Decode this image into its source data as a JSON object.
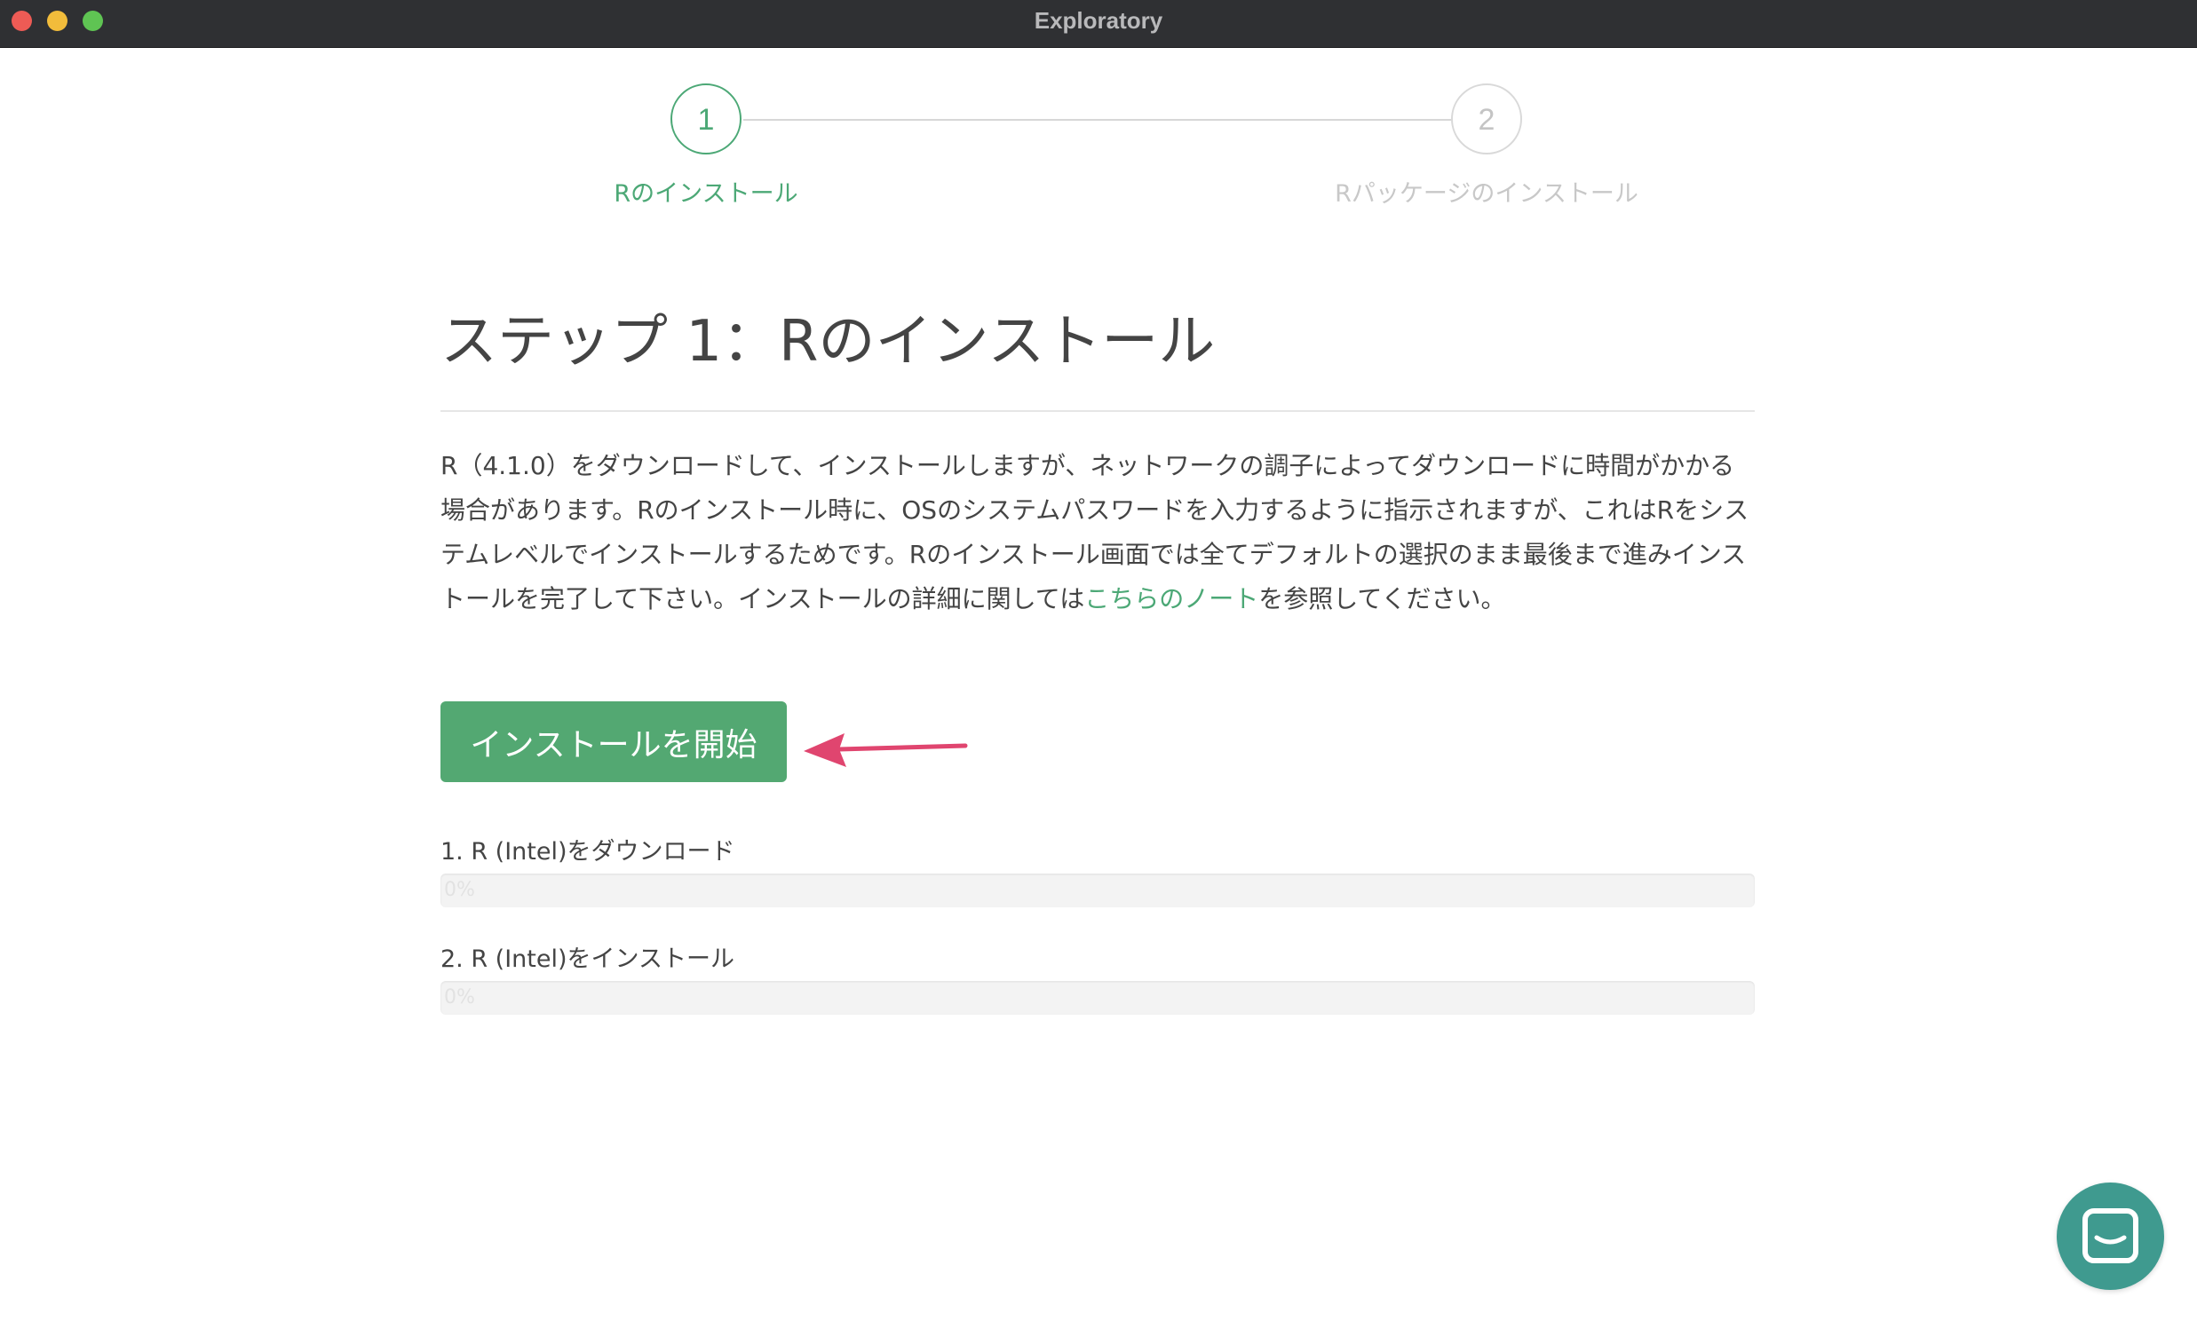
{
  "window": {
    "title": "Exploratory"
  },
  "stepper": {
    "steps": [
      {
        "number": "1",
        "label": "Rのインストール",
        "state": "active"
      },
      {
        "number": "2",
        "label": "Rパッケージのインストール",
        "state": "inactive"
      }
    ]
  },
  "main": {
    "heading": "ステップ 1：Rのインストール",
    "description_before_link": "R（4.1.0）をダウンロードして、インストールしますが、ネットワークの調子によってダウンロードに時間がかかる場合があります。Rのインストール時に、OSのシステムパスワードを入力するように指示されますが、これはRをシステムレベルでインストールするためです。Rのインストール画面では全てデフォルトの選択のまま最後まで進みインストールを完了して下さい。インストールの詳細に関しては",
    "description_link": "こちらのノート",
    "description_after_link": "を参照してください。",
    "start_button_label": "インストールを開始"
  },
  "progress": [
    {
      "label": "1. R (Intel)をダウンロード",
      "percent_text": "0%",
      "value": 0
    },
    {
      "label": "2. R (Intel)をインストール",
      "percent_text": "0%",
      "value": 0
    }
  ],
  "colors": {
    "accent": "#4ca876",
    "button": "#53a872",
    "annotation_arrow": "#e0456f",
    "chat_bubble": "#3f9a8f"
  },
  "icons": {
    "annotation": "arrow-left-icon",
    "chat": "chat-icon"
  }
}
